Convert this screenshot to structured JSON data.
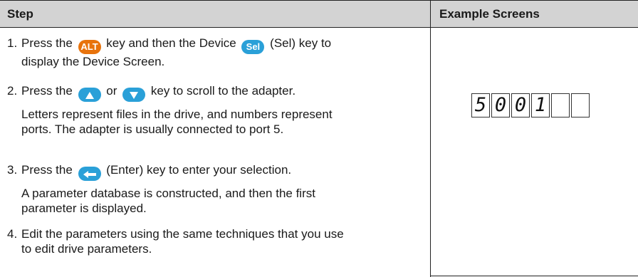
{
  "header": {
    "step": "Step",
    "example": "Example Screens"
  },
  "steps": [
    {
      "num": "1.",
      "pre": "Press the",
      "key": "ALT",
      "mid": "key and then the Device",
      "key2": "Sel",
      "post": "(Sel) key to",
      "line2": "display the Device Screen."
    },
    {
      "num": "2.",
      "pre": "Press the",
      "mid": "or",
      "post": "key to scroll to the adapter.",
      "note": "Letters represent files in the drive, and numbers represent",
      "note2": "ports. The adapter is usually connected to port 5."
    },
    {
      "num": "3.",
      "pre": "Press the",
      "post": "(Enter) key to enter your selection.",
      "note": "A parameter database is constructed, and then the first",
      "note2": "parameter is displayed."
    },
    {
      "num": "4.",
      "line1": "Edit the parameters using the same techniques that you use",
      "line2": "to edit drive parameters."
    }
  ],
  "display": {
    "cells": [
      "5",
      "0",
      "0",
      "1",
      "",
      ""
    ]
  },
  "icons": {
    "up": "up-arrow-icon",
    "down": "down-arrow-icon",
    "enter": "enter-icon"
  },
  "colors": {
    "alt_key": "#e8730c",
    "blue_key": "#2aa0d8",
    "header_bg": "#d3d3d3"
  }
}
